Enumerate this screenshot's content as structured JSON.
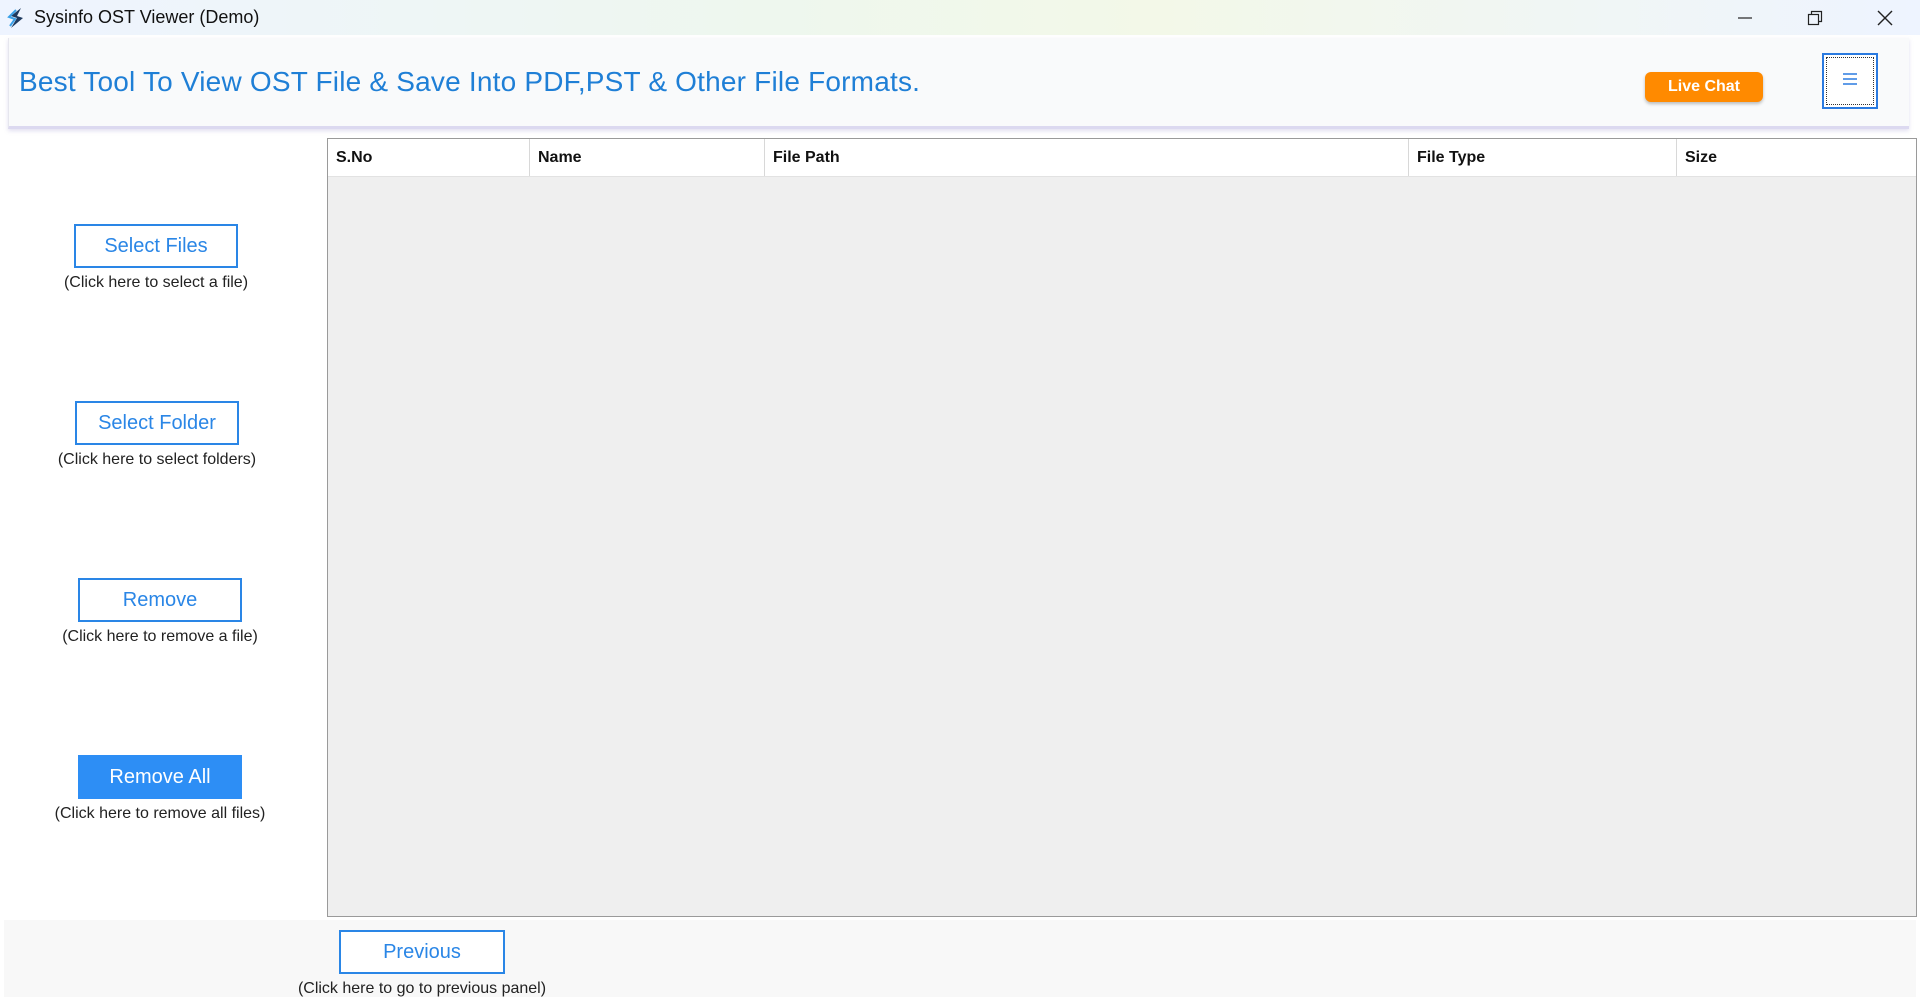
{
  "window": {
    "title": "Sysinfo OST Viewer (Demo)",
    "app_icon": "sysinfo-logo-icon",
    "controls": [
      "minimize-icon",
      "restore-icon",
      "close-icon"
    ]
  },
  "header": {
    "title": "Best Tool To View OST File & Save Into PDF,PST & Other File Formats.",
    "live_chat_label": "Live Chat",
    "menu_icon": "hamburger-menu-icon",
    "accent_color": "#1f7fd6",
    "live_chat_color": "#ff8a00"
  },
  "actions": {
    "select_files": {
      "label": "Select Files",
      "hint": "(Click here to select a file)"
    },
    "select_folder": {
      "label": "Select Folder",
      "hint": "(Click here to select folders)"
    },
    "remove": {
      "label": "Remove",
      "hint": "(Click here to remove a file)"
    },
    "remove_all": {
      "label": "Remove All",
      "hint": "(Click here to remove all files)"
    }
  },
  "table": {
    "columns": [
      "S.No",
      "Name",
      "File Path",
      "File Type",
      "Size"
    ],
    "rows": []
  },
  "footer": {
    "previous": {
      "label": "Previous",
      "hint": "(Click here to go to previous panel)"
    }
  }
}
